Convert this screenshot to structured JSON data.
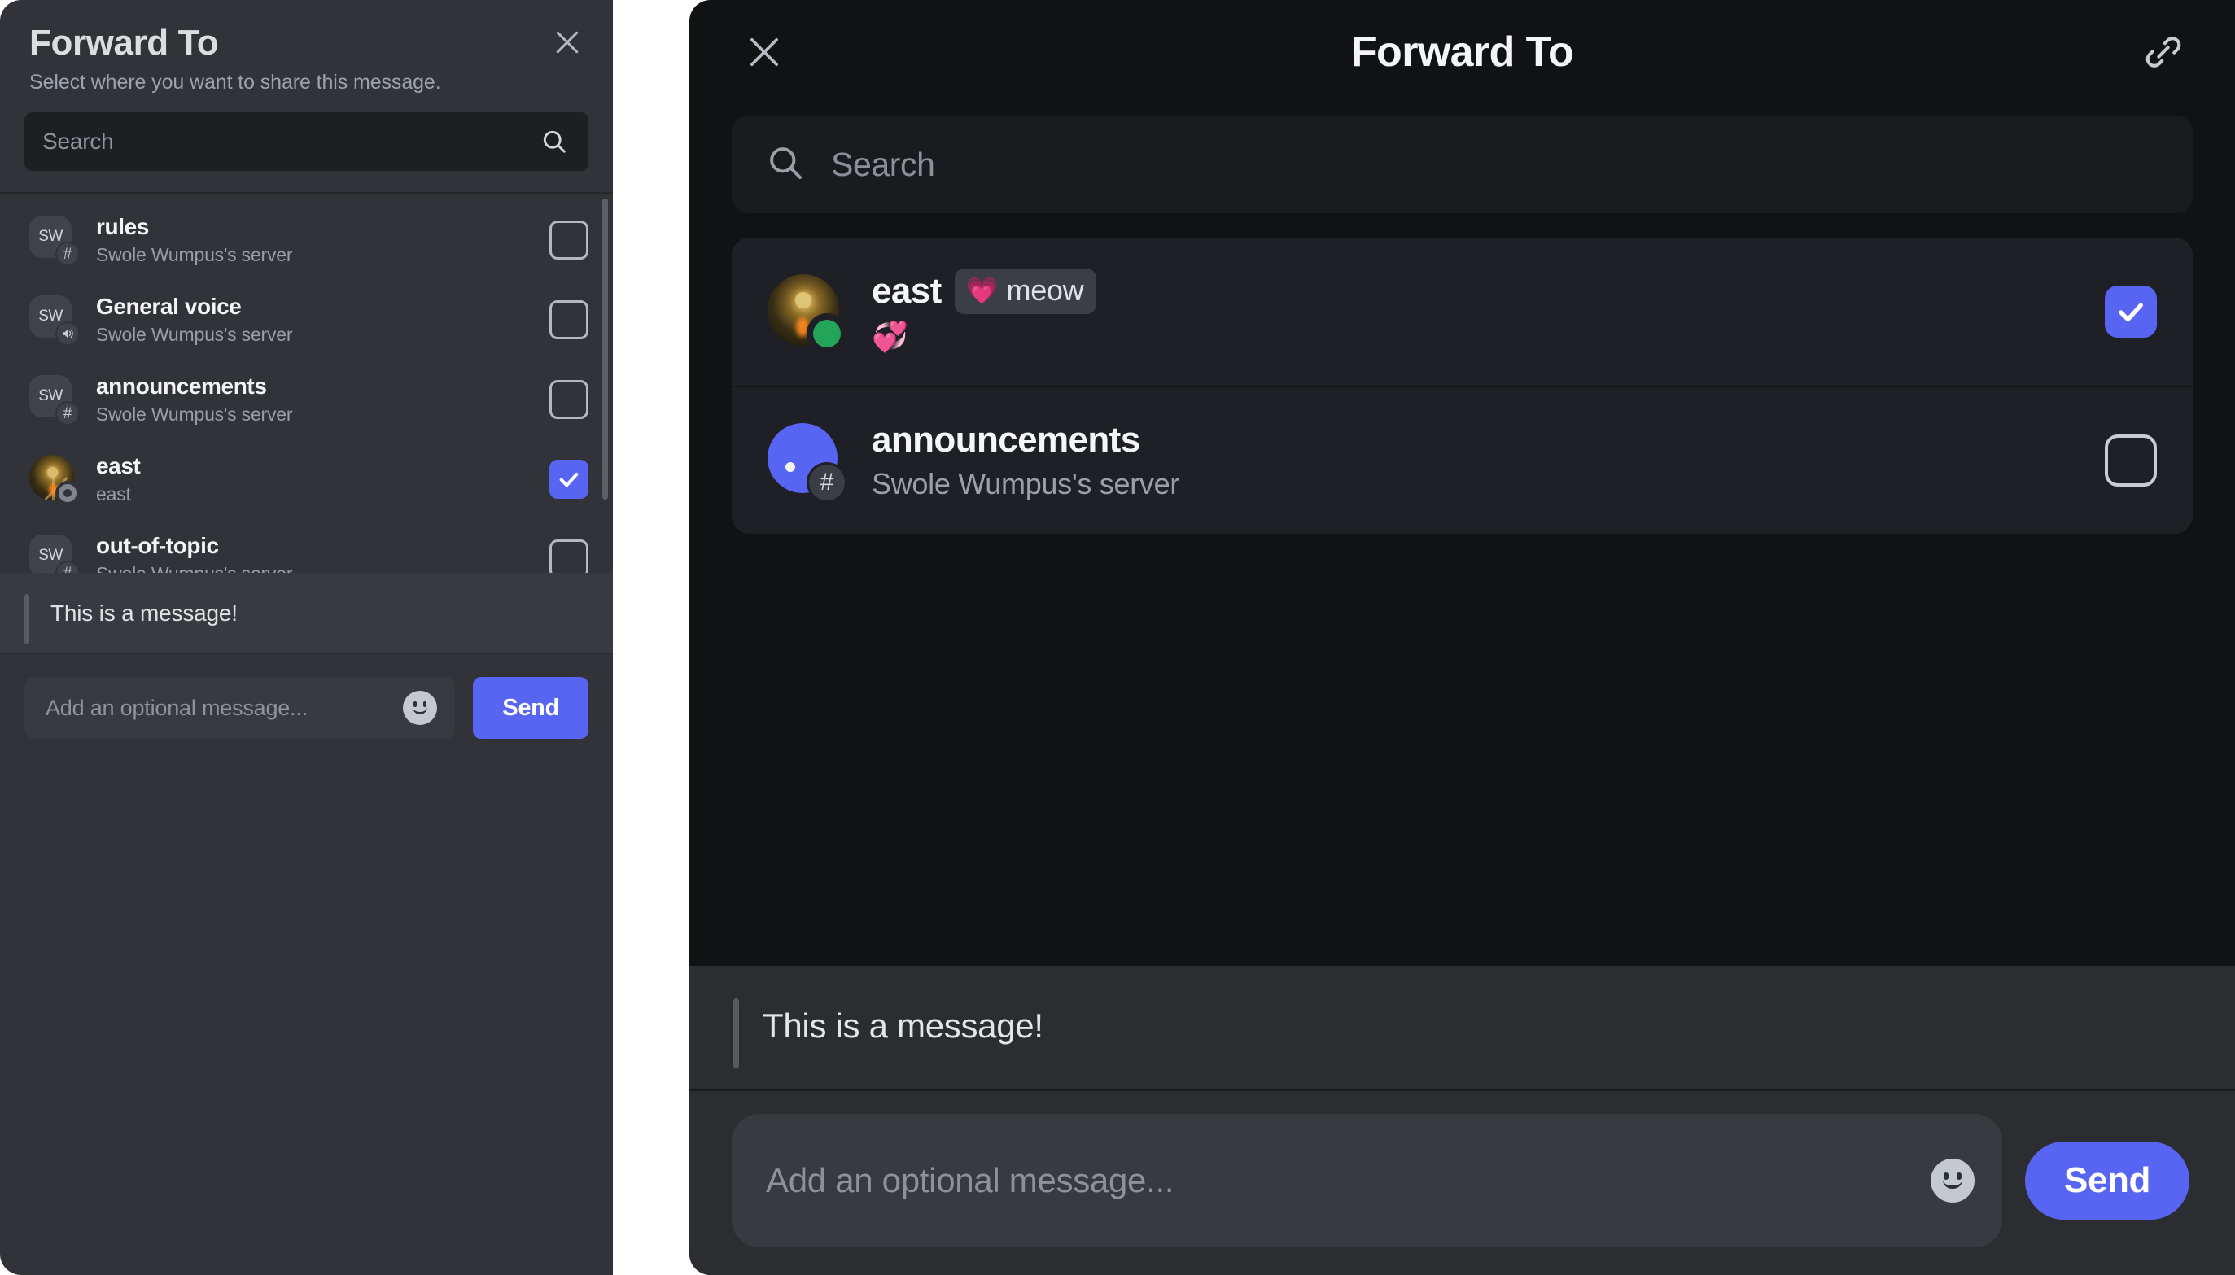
{
  "colors": {
    "accent": "#5865F2",
    "desktop_bg": "#313338",
    "mobile_bg": "#111214",
    "card_bg": "#1F2025",
    "input_bg": "#383A40",
    "online_green": "#23A559",
    "idle_grey": "#80848E"
  },
  "desktop": {
    "title": "Forward To",
    "subtitle": "Select where you want to share this message.",
    "close_icon": "close-icon",
    "search": {
      "placeholder": "Search",
      "value": "",
      "icon": "search-icon"
    },
    "items": [
      {
        "name": "rules",
        "description": "Swole Wumpus's server",
        "avatar_text": "SW",
        "badge_icon": "hash-icon",
        "checked": false
      },
      {
        "name": "General voice",
        "description": "Swole Wumpus's server",
        "avatar_text": "SW",
        "badge_icon": "speaker-icon",
        "checked": false
      },
      {
        "name": "announcements",
        "description": "Swole Wumpus's server",
        "avatar_text": "SW",
        "badge_icon": "hash-icon",
        "checked": false
      },
      {
        "name": "east",
        "description": "east",
        "avatar_text": "",
        "badge_icon": "status-idle-icon",
        "checked": true
      },
      {
        "name": "out-of-topic",
        "description": "Swole Wumpus's server",
        "avatar_text": "SW",
        "badge_icon": "hash-icon",
        "checked": false
      }
    ],
    "quoted_message": "This is a message!",
    "compose": {
      "placeholder": "Add an optional message...",
      "value": "",
      "emoji_icon": "smiley-icon"
    },
    "send_label": "Send"
  },
  "mobile": {
    "title": "Forward To",
    "close_icon": "close-icon",
    "link_icon": "link-icon",
    "search": {
      "placeholder": "Search",
      "value": "",
      "icon": "search-icon"
    },
    "items": [
      {
        "name": "east",
        "tag_emoji": "💗",
        "tag_text": "meow",
        "status_emoji": "💞",
        "description": "",
        "badge_icon": "status-online-icon",
        "checked": true
      },
      {
        "name": "announcements",
        "tag_emoji": "",
        "tag_text": "",
        "status_emoji": "",
        "description": "Swole Wumpus's server",
        "badge_icon": "hash-icon",
        "checked": false
      }
    ],
    "quoted_message": "This is a message!",
    "compose": {
      "placeholder": "Add an optional message...",
      "value": "",
      "emoji_icon": "smiley-icon"
    },
    "send_label": "Send"
  }
}
